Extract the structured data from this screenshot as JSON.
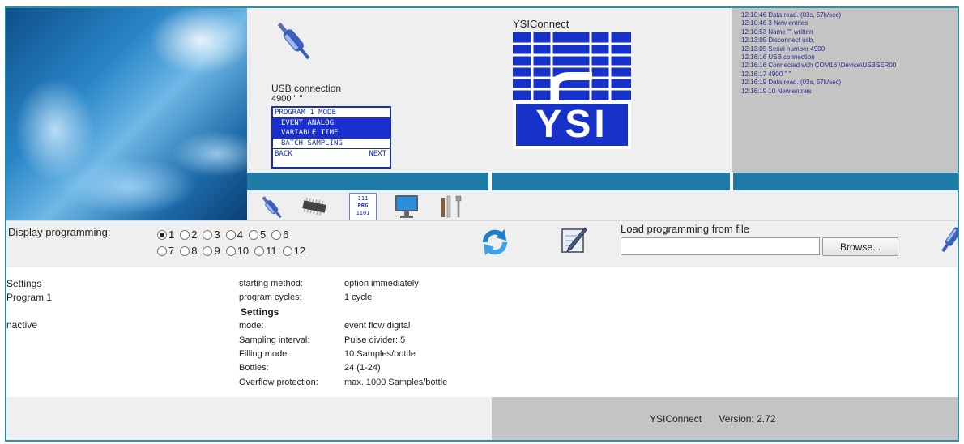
{
  "header": {
    "usb": {
      "label": "USB connection",
      "serial": "4900 \" \"",
      "lcd": {
        "title": "PROGRAM 1 MODE",
        "options": [
          "EVENT ANALOG",
          "VARIABLE TIME",
          "BATCH SAMPLING"
        ],
        "back": "BACK",
        "next": "NEXT"
      }
    },
    "ysi": {
      "title": "YSIConnect",
      "logo_text": "YSI"
    },
    "log": [
      "12:10:46 Data read. (03s, 57k/sec)",
      "12:10:46 3 New entries",
      "12:10:53 Name \"\" written",
      "12:13:05 Disconnect usb,",
      "12:13:05 Serial number 4900",
      "12:16:16 USB connection",
      "12:16:16 Connected with COM16 \\Device\\USBSER00",
      "12:16:17 4900 \" \"",
      "12:16:19 Data read. (03s, 57k/sec)",
      "12:16:19 10 New entries"
    ]
  },
  "toolbar": {
    "icons": [
      "usb-plug-icon",
      "chip-icon",
      "prg-file-icon",
      "monitor-icon",
      "tools-icon"
    ],
    "prg_label_top": "111",
    "prg_label": "PRG",
    "prg_label_bottom": "1101"
  },
  "programming": {
    "label": "Display programming:",
    "options_row1": [
      "1",
      "2",
      "3",
      "4",
      "5",
      "6"
    ],
    "options_row2": [
      "7",
      "8",
      "9",
      "10",
      "11",
      "12"
    ],
    "selected": "1",
    "load_label": "Load programming from file",
    "file_value": "",
    "browse_label": "Browse..."
  },
  "settings": {
    "left": {
      "title": "Settings",
      "program": "Program 1",
      "status": "nactive"
    },
    "rows_top": [
      {
        "key": "starting method:",
        "value": "option immediately"
      },
      {
        "key": "program cycles:",
        "value": "1 cycle"
      }
    ],
    "subheading": "Settings",
    "rows_bottom": [
      {
        "key": "mode:",
        "value": "event flow digital"
      },
      {
        "key": "Sampling interval:",
        "value": "Pulse divider: 5"
      },
      {
        "key": "Filling mode:",
        "value": "10 Samples/bottle"
      },
      {
        "key": "Bottles:",
        "value": "24 (1-24)"
      },
      {
        "key": "Overflow protection:",
        "value": "max. 1000 Samples/bottle"
      }
    ]
  },
  "footer": {
    "app": "YSIConnect",
    "version": "Version: 2.72"
  },
  "colors": {
    "frame": "#2f8ea3",
    "bluebar": "#1e7ba8",
    "logo_blue": "#1632c8",
    "panel_light": "#efefef",
    "panel_dark": "#c4c4c4"
  }
}
